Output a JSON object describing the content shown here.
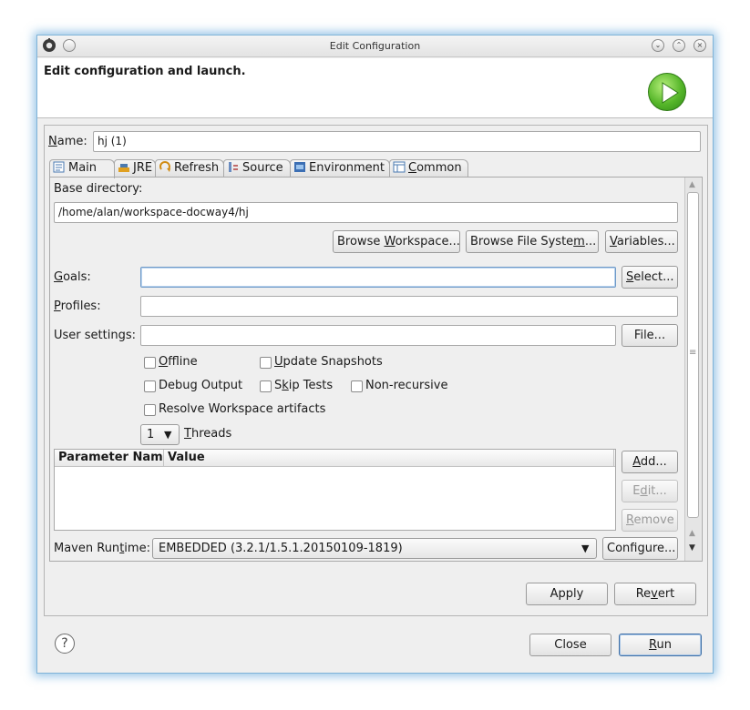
{
  "window": {
    "title": "Edit Configuration",
    "header_title": "Edit configuration and launch."
  },
  "name_field": {
    "label_prefix": "",
    "label_mn": "N",
    "label_rest": "ame:",
    "value": "hj (1)"
  },
  "tabs": [
    {
      "label": "Main",
      "icon": "main-tab-icon"
    },
    {
      "label": "JRE",
      "icon": "jre-icon"
    },
    {
      "label": "Refresh",
      "icon": "refresh-icon"
    },
    {
      "label": "Source",
      "icon": "source-icon"
    },
    {
      "label": "Environment",
      "icon": "environment-icon"
    },
    {
      "label_mn": "C",
      "label_rest": "ommon",
      "icon": "common-icon"
    }
  ],
  "main": {
    "base_directory_label": "Base directory:",
    "base_directory_value": "/home/alan/workspace-docway4/hj",
    "browse_workspace": {
      "pre": "Browse ",
      "mn": "W",
      "post": "orkspace..."
    },
    "browse_fs": {
      "pre": "Browse File Syste",
      "mn": "m",
      "post": "..."
    },
    "variables": {
      "pre": "",
      "mn": "V",
      "post": "ariables..."
    },
    "goals_label": {
      "mn": "G",
      "rest": "oals:"
    },
    "goals_value": "",
    "select_button": {
      "mn": "S",
      "rest": "elect..."
    },
    "profiles_label": {
      "mn": "P",
      "rest": "rofiles:"
    },
    "profiles_value": "",
    "user_settings_label": "User settings:",
    "user_settings_value": "",
    "file_button": "File...",
    "checkboxes": {
      "offline": {
        "mn": "O",
        "rest": "ffline",
        "checked": false
      },
      "update_snapshots": {
        "mn": "U",
        "rest": "pdate Snapshots",
        "checked": false
      },
      "debug_output": {
        "label": "Debug Output",
        "checked": false
      },
      "skip_tests": {
        "pre": "S",
        "mn": "k",
        "rest": "ip Tests",
        "checked": false
      },
      "non_recursive": {
        "label": "Non-recursive",
        "checked": false
      },
      "resolve_workspace": {
        "label": "Resolve Workspace artifacts",
        "checked": false
      }
    },
    "threads_value": "1",
    "threads_label": {
      "mn": "T",
      "rest": "hreads"
    },
    "param_table": {
      "columns": [
        "Parameter Nam",
        "Value"
      ],
      "rows": []
    },
    "add_button": {
      "mn": "A",
      "rest": "dd..."
    },
    "edit_button": {
      "pre": "E",
      "mn": "d",
      "rest": "it..."
    },
    "remove_button": {
      "mn": "R",
      "rest": "emove"
    },
    "maven_runtime_label": {
      "pre": "Maven Run",
      "mn": "t",
      "rest": "ime:"
    },
    "maven_runtime_value": "EMBEDDED (3.2.1/1.5.1.20150109-1819)",
    "configure_button": "Configure..."
  },
  "footer": {
    "apply": "Apply",
    "revert": {
      "pre": "Re",
      "mn": "v",
      "rest": "ert"
    },
    "close": "Close",
    "run": {
      "mn": "R",
      "rest": "un"
    },
    "help_glyph": "?"
  },
  "colors": {
    "window_glow": "#4696d2",
    "run_green": "#56b62a",
    "focus_border": "#6f9ac8"
  }
}
